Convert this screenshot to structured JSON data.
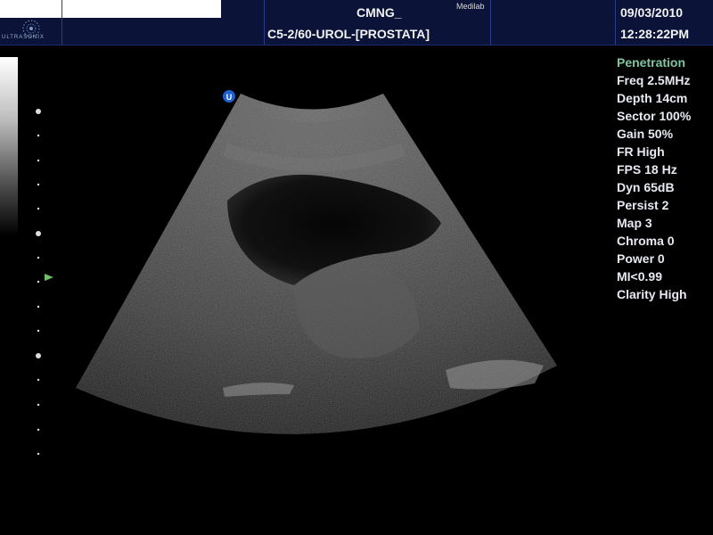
{
  "header": {
    "hospital_name": "CMNG_",
    "lab_name": "Medilab",
    "probe_info": "C5-2/60-UROL-[PROSTATA]",
    "date": "09/03/2010",
    "time": "12:28:22PM",
    "logo_text": "ULTRASONIX"
  },
  "params": {
    "title": "Penetration",
    "items": [
      "Freq 2.5MHz",
      "Depth 14cm",
      "Sector 100%",
      "Gain 50%",
      "FR High",
      "FPS 18 Hz",
      "Dyn 65dB",
      "Persist 2",
      "Map 3",
      "Chroma 0",
      "Power 0",
      "MI<0.99",
      "Clarity High"
    ]
  },
  "colors": {
    "header_bg": "#0b1438",
    "param_title": "#7fc6a0",
    "param_text": "#e7eaf2"
  },
  "image": {
    "orientation_marker": "U",
    "description_icons": [
      "gray-scale-bar",
      "depth-scale-dots",
      "focus-marker-icon"
    ]
  }
}
